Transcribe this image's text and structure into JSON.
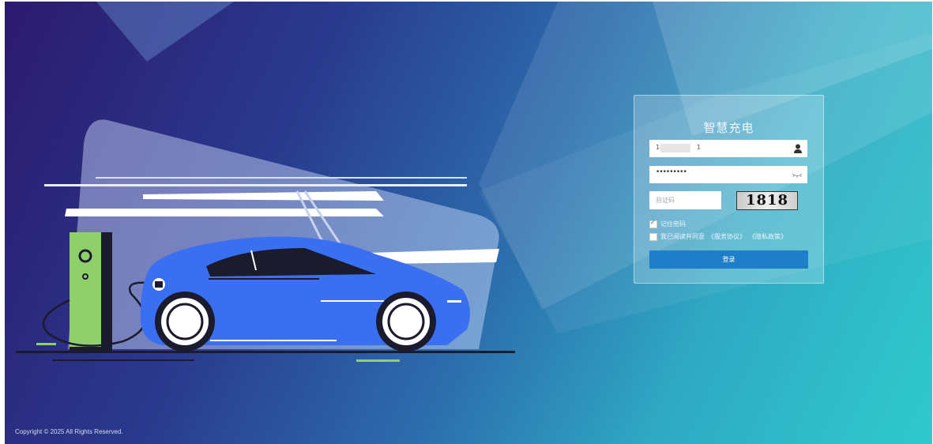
{
  "app": {
    "title": "智慧充电"
  },
  "form": {
    "username_prefix": "18",
    "username_suffix": "1",
    "password_masked": "•••••••••",
    "captcha_placeholder": "验证码",
    "captcha_code": "1818",
    "remember_label": "记住密码",
    "remember_checked": true,
    "agree_text": "我已阅读并同意",
    "service_agreement": "《服务协议》",
    "privacy_policy": "《隐私政策》",
    "agree_checked": false,
    "login_button": "登录"
  },
  "footer": {
    "copyright": "Copyright © 2025 All Rights Reserved."
  },
  "icons": {
    "user": "user-icon",
    "password_eye": "eye-closed-icon"
  },
  "colors": {
    "primary_button": "#1e7fc8",
    "car_body": "#3b6ff2",
    "charger": "#8fd06a",
    "background_start": "#2c1a6e",
    "background_end": "#2fcacb"
  }
}
